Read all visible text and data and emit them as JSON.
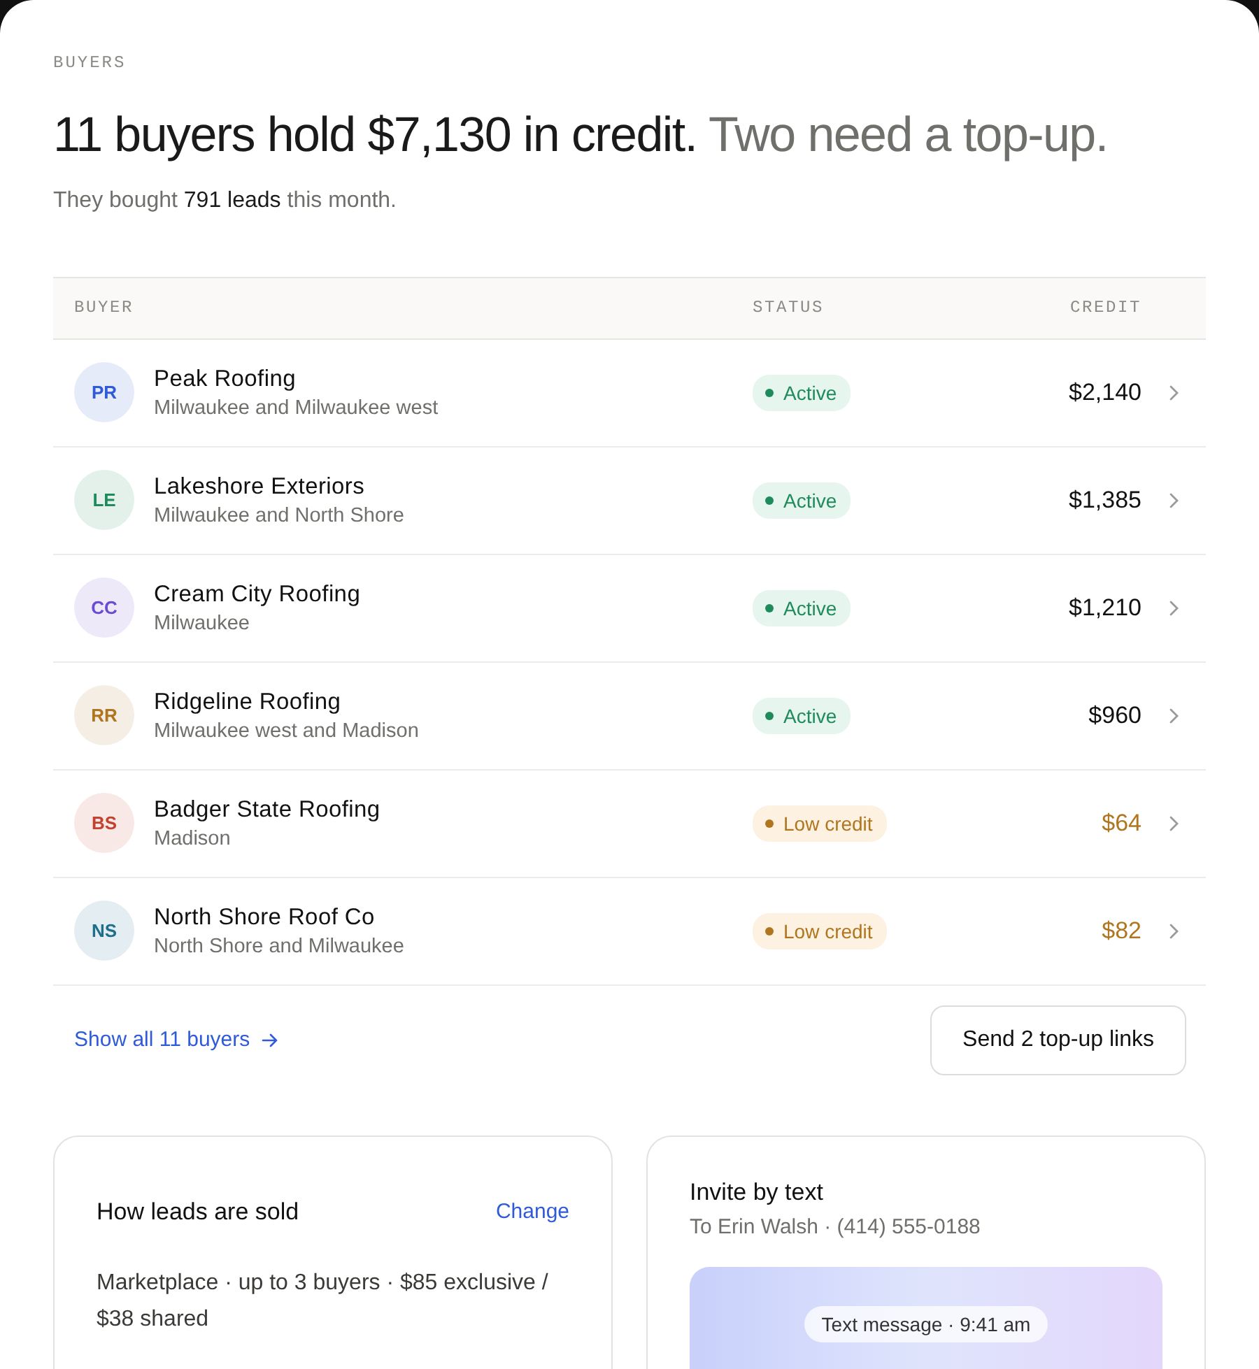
{
  "section_label": "BUYERS",
  "headline": {
    "lead": "11 buyers hold $7,130 in credit.",
    "tail": "Two need a top-up."
  },
  "summary": "They bought **791 leads** this month.",
  "table": {
    "columns": [
      "BUYER",
      "STATUS",
      "CREDIT"
    ],
    "rows": [
      {
        "initials": "PR",
        "color": "#2f5bd8",
        "name": "Peak Roofing",
        "area": "Milwaukee and Milwaukee west",
        "status": {
          "kind": "active",
          "label": "Active"
        },
        "credit": "$2,140"
      },
      {
        "initials": "LE",
        "color": "#1f8a5b",
        "name": "Lakeshore Exteriors",
        "area": "Milwaukee and North Shore",
        "status": {
          "kind": "active",
          "label": "Active"
        },
        "credit": "$1,385"
      },
      {
        "initials": "CC",
        "color": "#6a4bd1",
        "name": "Cream City Roofing",
        "area": "Milwaukee",
        "status": {
          "kind": "active",
          "label": "Active"
        },
        "credit": "$1,210"
      },
      {
        "initials": "RR",
        "color": "#b0761f",
        "name": "Ridgeline Roofing",
        "area": "Milwaukee west and Madison",
        "status": {
          "kind": "active",
          "label": "Active"
        },
        "credit": "$960"
      },
      {
        "initials": "BS",
        "color": "#c2412f",
        "name": "Badger State Roofing",
        "area": "Madison",
        "status": {
          "kind": "low",
          "label": "Low credit"
        },
        "credit": "$64"
      },
      {
        "initials": "NS",
        "color": "#1f6f8a",
        "name": "North Shore Roof Co",
        "area": "North Shore and Milwaukee",
        "status": {
          "kind": "low",
          "label": "Low credit"
        },
        "credit": "$82"
      }
    ]
  },
  "show_all_link": "Show all 11 buyers",
  "send_button": "Send 2 top-up links",
  "sales_card": {
    "title": "How leads are sold",
    "action": "Change",
    "description": "Marketplace · up to 3 buyers · $85 exclusive / $38 shared"
  },
  "invite_card": {
    "title": "Invite by text",
    "recipient": "To Erin Walsh · (414) 555-0188",
    "message_meta": "Text message · 9:41 am"
  }
}
